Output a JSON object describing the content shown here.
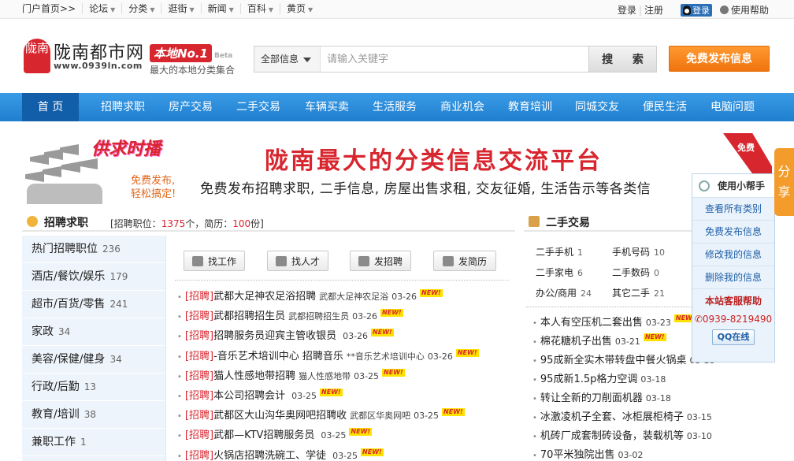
{
  "topbar": {
    "nav": [
      {
        "label": "门户首页>>",
        "arrow": false
      },
      {
        "label": "论坛",
        "arrow": true
      },
      {
        "label": "分类",
        "arrow": true
      },
      {
        "label": "逛街",
        "arrow": true
      },
      {
        "label": "新闻",
        "arrow": true
      },
      {
        "label": "百科",
        "arrow": true
      },
      {
        "label": "黄页",
        "arrow": true
      }
    ],
    "login": "登录",
    "register": "注册",
    "qq_login": "登录",
    "help": "使用帮助"
  },
  "header": {
    "logo_badge": "陇南",
    "logo_name": "陇南都市网",
    "logo_url": "www.0939ln.com",
    "no1": "本地No.1",
    "beta": "Beta",
    "no1_sub": "最大的本地分类集合",
    "search_category": "全部信息",
    "search_placeholder": "请输入关键字",
    "search_button": "搜 索",
    "publish_button": "免费发布信息"
  },
  "mainnav": [
    "首 页",
    "招聘求职",
    "房产交易",
    "二手交易",
    "车辆买卖",
    "生活服务",
    "商业机会",
    "教育培训",
    "同城交友",
    "便民生活",
    "电脑问题"
  ],
  "banner": {
    "stamp": "供求时播",
    "free_line1": "免费发布,",
    "free_line2": "轻松搞定!",
    "title": "陇南最大的分类信息交流平台",
    "subtitle": "免费发布招聘求职, 二手信息, 房屋出售求租, 交友征婚, 生活告示等各类信",
    "corner": "免费"
  },
  "recruit": {
    "title": "招聘求职",
    "stat_prefix": "[招聘职位：",
    "positions": "1375",
    "stat_mid": "个，简历：",
    "resumes": "100",
    "stat_suffix": "份]",
    "categories": [
      {
        "name": "热门招聘职位",
        "count": "236"
      },
      {
        "name": "酒店/餐饮/娱乐",
        "count": "179"
      },
      {
        "name": "超市/百货/零售",
        "count": "241"
      },
      {
        "name": "家政",
        "count": "34"
      },
      {
        "name": "美容/保健/健身",
        "count": "34"
      },
      {
        "name": "行政/后勤",
        "count": "13"
      },
      {
        "name": "教育/培训",
        "count": "38"
      },
      {
        "name": "兼职工作",
        "count": "1"
      }
    ],
    "actions": [
      "找工作",
      "找人才",
      "发招聘",
      "发简历"
    ],
    "new_badge": "NEW!",
    "jobs": [
      {
        "tag": "[招聘]",
        "title": "武都大足神农足浴招聘",
        "company": "武都大足神农足浴",
        "date": "03-26"
      },
      {
        "tag": "[招聘]",
        "title": "武都招聘招生员",
        "company": "武都招聘招生员",
        "date": "03-26"
      },
      {
        "tag": "[招聘]",
        "title": "招聘服务员迎宾主管收银员",
        "company": "",
        "date": "03-26"
      },
      {
        "tag": "[招聘]",
        "title": "-音乐艺术培训中心 招聘音乐",
        "company": "**音乐艺术培训中心",
        "date": "03-26"
      },
      {
        "tag": "[招聘]",
        "title": "猫人性感地带招聘",
        "company": "猫人性感地带",
        "date": "03-25"
      },
      {
        "tag": "[招聘]",
        "title": "本公司招聘会计",
        "company": "",
        "date": "03-25"
      },
      {
        "tag": "[招聘]",
        "title": "武都区大山沟华奥网吧招聘收",
        "company": "武都区华奥网吧",
        "date": "03-25"
      },
      {
        "tag": "[招聘]",
        "title": "武都—KTV招聘服务员",
        "company": "",
        "date": "03-25"
      },
      {
        "tag": "[招聘]",
        "title": "火锅店招聘洗碗工、学徒",
        "company": "",
        "date": "03-25"
      }
    ]
  },
  "secondhand": {
    "title": "二手交易",
    "categories": [
      {
        "name": "二手手机",
        "count": "1"
      },
      {
        "name": "手机号码",
        "count": "10"
      },
      {
        "name": "二手家电",
        "count": "6"
      },
      {
        "name": "二手数码",
        "count": "0"
      },
      {
        "name": "办公/商用",
        "count": "24"
      },
      {
        "name": "其它二手",
        "count": "21"
      }
    ],
    "items": [
      {
        "title": "本人有空压机二套出售",
        "date": "03-23",
        "new": true
      },
      {
        "title": "棉花糖机子出售",
        "date": "03-21",
        "new": true
      },
      {
        "title": "95成新全实木带转盘中餐火锅桌",
        "date": "03-18",
        "new": false
      },
      {
        "title": "95成新1.5p格力空调",
        "date": "03-18",
        "new": false
      },
      {
        "title": "转让全新的刀削面机器",
        "date": "03-18",
        "new": false
      },
      {
        "title": "冰激凌机子全套、冰柜展柜椅子",
        "date": "03-15",
        "new": false
      },
      {
        "title": "机砖厂成套制砖设备，装载机等",
        "date": "03-10",
        "new": false
      },
      {
        "title": "70平米独院出售",
        "date": "03-02",
        "new": false
      }
    ]
  },
  "helper": {
    "title": "使用小帮手",
    "items": [
      "查看所有类别",
      "免费发布信息",
      "修改我的信息",
      "删除我的信息"
    ],
    "service_title": "本站客服帮助",
    "phone": "0939-8219490",
    "qq_button": "QQ在线"
  },
  "share_tab": "分享"
}
